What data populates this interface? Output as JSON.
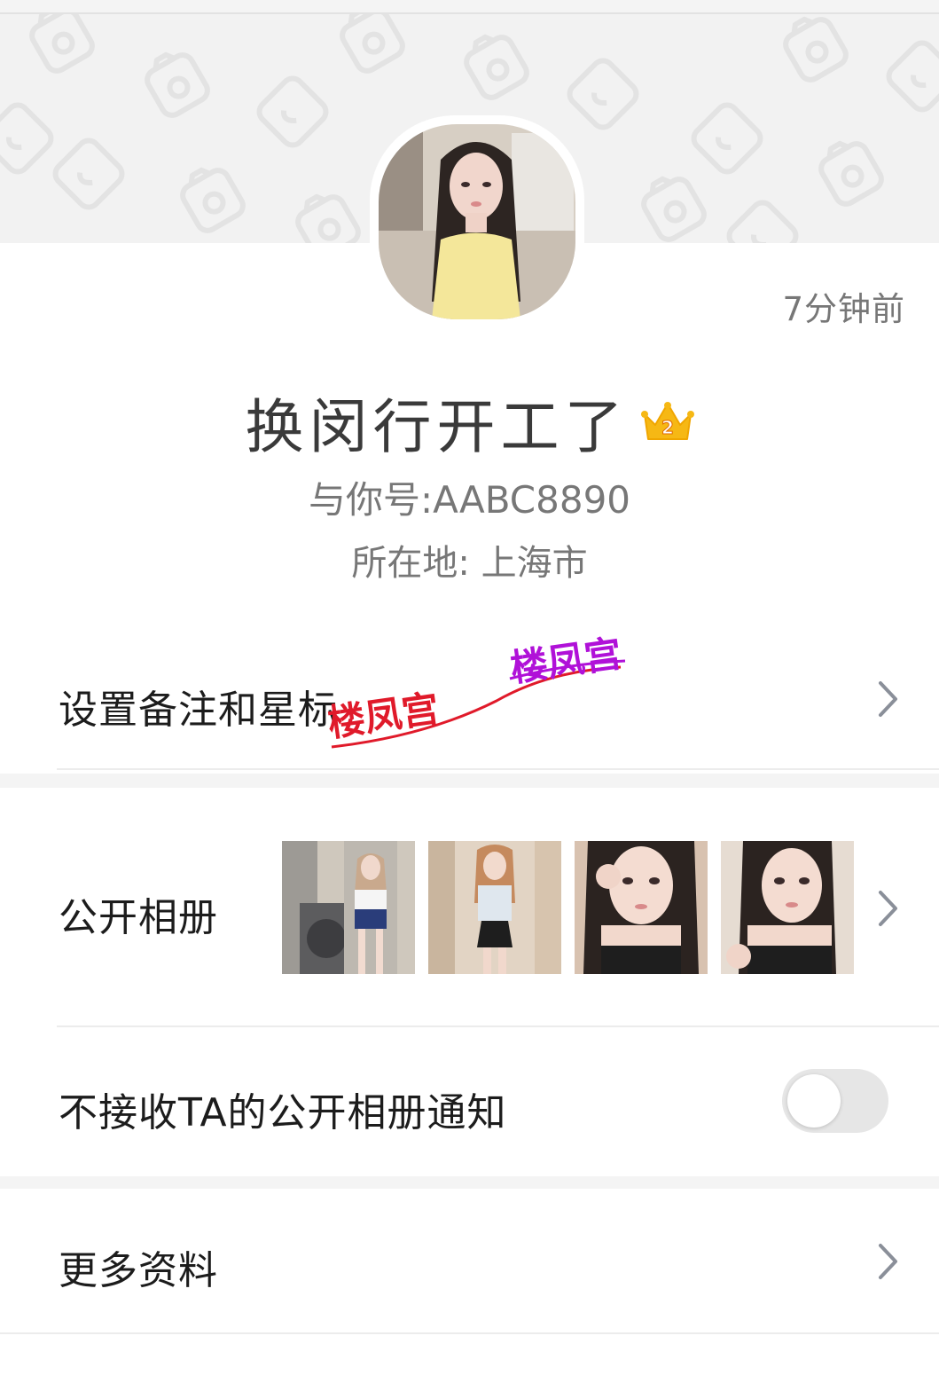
{
  "profile": {
    "last_seen": "7分钟前",
    "nickname": "换闵行开工了",
    "vip_level": "2",
    "uid": "与你号:AABC8890",
    "location": "所在地: 上海市"
  },
  "rows": {
    "remark": {
      "label": "设置备注和星标"
    },
    "album": {
      "label": "公开相册",
      "photo_count_shown": 4
    },
    "notify": {
      "label": "不接收TA的公开相册通知",
      "toggle_on": false
    },
    "more": {
      "label": "更多资料"
    }
  },
  "watermark": {
    "text": "楼凤宫"
  },
  "icons": {
    "crown": "crown-badge-icon",
    "chevron": "chevron-right-icon",
    "cover_pattern": "camera-pattern-icon"
  },
  "colors": {
    "chevron": "#8a8f99",
    "crown_gold": "#f6b814",
    "watermark_red": "#e01a2a",
    "watermark_purple": "#b011d8"
  }
}
